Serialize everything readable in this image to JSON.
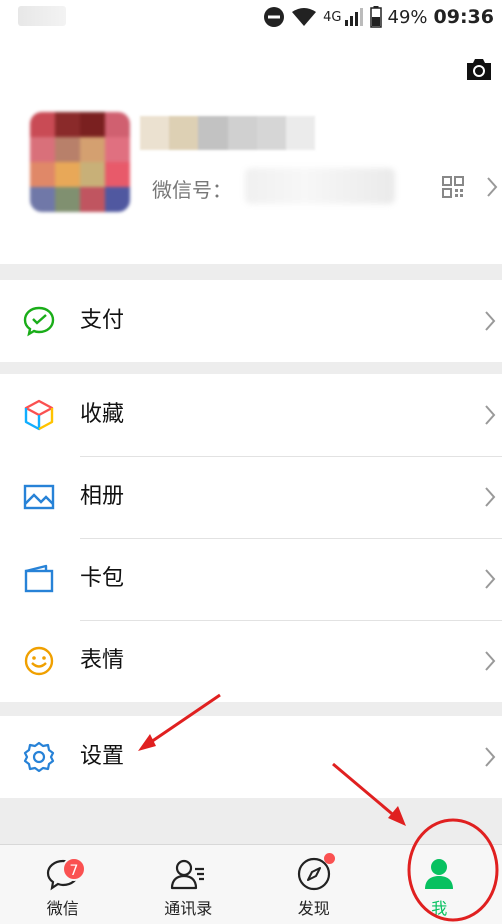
{
  "status_bar": {
    "network": "4G",
    "battery": "49%",
    "time": "09:36"
  },
  "profile": {
    "wxid_label": "微信号："
  },
  "menu": {
    "group1": [
      {
        "name": "pay",
        "label": "支付",
        "icon": "wechat-pay-icon"
      }
    ],
    "group2": [
      {
        "name": "favorites",
        "label": "收藏",
        "icon": "cube-icon"
      },
      {
        "name": "album",
        "label": "相册",
        "icon": "picture-icon"
      },
      {
        "name": "cards",
        "label": "卡包",
        "icon": "wallet-icon"
      },
      {
        "name": "stickers",
        "label": "表情",
        "icon": "smile-icon"
      }
    ],
    "group3": [
      {
        "name": "settings",
        "label": "设置",
        "icon": "gear-icon"
      }
    ]
  },
  "tabbar": {
    "chats": {
      "label": "微信",
      "badge": "7"
    },
    "contacts": {
      "label": "通讯录"
    },
    "discover": {
      "label": "发现"
    },
    "me": {
      "label": "我"
    }
  },
  "colors": {
    "accent": "#07c160",
    "badge": "#fa5151",
    "annotation": "#e02020"
  }
}
